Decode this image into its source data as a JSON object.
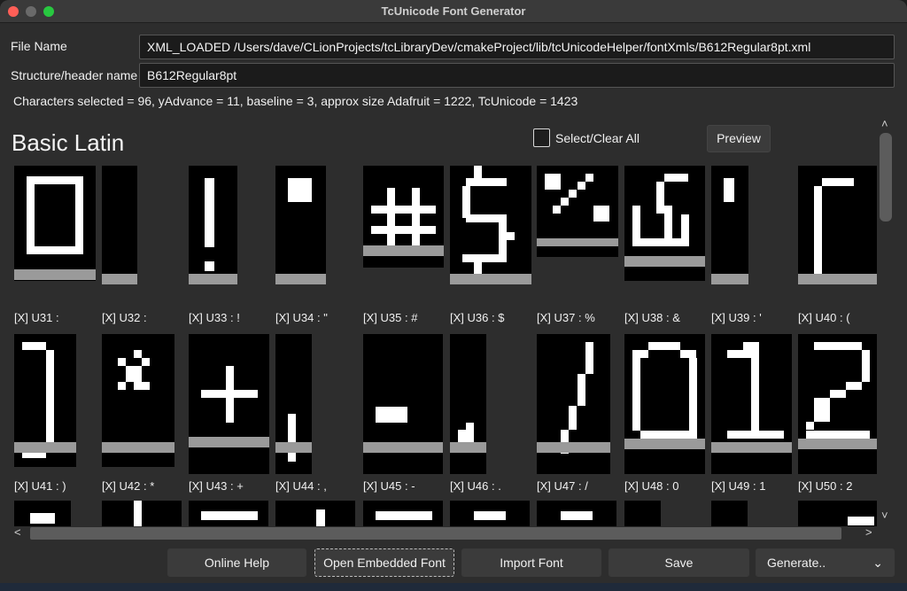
{
  "window": {
    "title": "TcUnicode Font Generator"
  },
  "form": {
    "file_name_label": "File Name",
    "file_name_value": "XML_LOADED /Users/dave/CLionProjects/tcLibraryDev/cmakeProject/lib/tcUnicodeHelper/fontXmls/B612Regular8pt.xml",
    "struct_label": "Structure/header name",
    "struct_value": "B612Regular8pt",
    "selection_info": "Characters selected = 96, yAdvance = 11, baseline = 3, approx size Adafruit = 1222, TcUnicode = 1423"
  },
  "section": {
    "title": "Basic Latin",
    "select_clear_label": "Select/Clear All",
    "preview_label": "Preview"
  },
  "glyphs": [
    {
      "caption": "[X] U31 :"
    },
    {
      "caption": "[X] U32 :"
    },
    {
      "caption": "[X] U33 : !"
    },
    {
      "caption": "[X] U34 : \""
    },
    {
      "caption": "[X] U35 : #"
    },
    {
      "caption": "[X] U36 : $"
    },
    {
      "caption": "[X] U37 : %"
    },
    {
      "caption": "[X] U38 : &"
    },
    {
      "caption": "[X] U39 : '"
    },
    {
      "caption": "[X] U40 : ("
    },
    {
      "caption": "[X] U41 : )"
    },
    {
      "caption": "[X] U42 : *"
    },
    {
      "caption": "[X] U43 : +"
    },
    {
      "caption": "[X] U44 : ,"
    },
    {
      "caption": "[X] U45 : -"
    },
    {
      "caption": "[X] U46 : ."
    },
    {
      "caption": "[X] U47 : /"
    },
    {
      "caption": "[X] U48 : 0"
    },
    {
      "caption": "[X] U49 : 1"
    },
    {
      "caption": "[X] U50 : 2"
    }
  ],
  "buttons": {
    "online_help": "Online Help",
    "open_embedded": "Open Embedded Font",
    "import_font": "Import Font",
    "save": "Save",
    "generate": "Generate.."
  },
  "icons": {
    "scroll_up": "^",
    "scroll_down": "v",
    "scroll_left": "<",
    "scroll_right": ">",
    "dropdown": "chevron-down"
  },
  "colors": {
    "background": "#2d2d2d",
    "field_bg": "#1b1b1b",
    "glyph_bg": "#000000",
    "glyph_px": "#ffffff",
    "baseline": "#9a9a9a",
    "button": "#3b3b3b"
  }
}
